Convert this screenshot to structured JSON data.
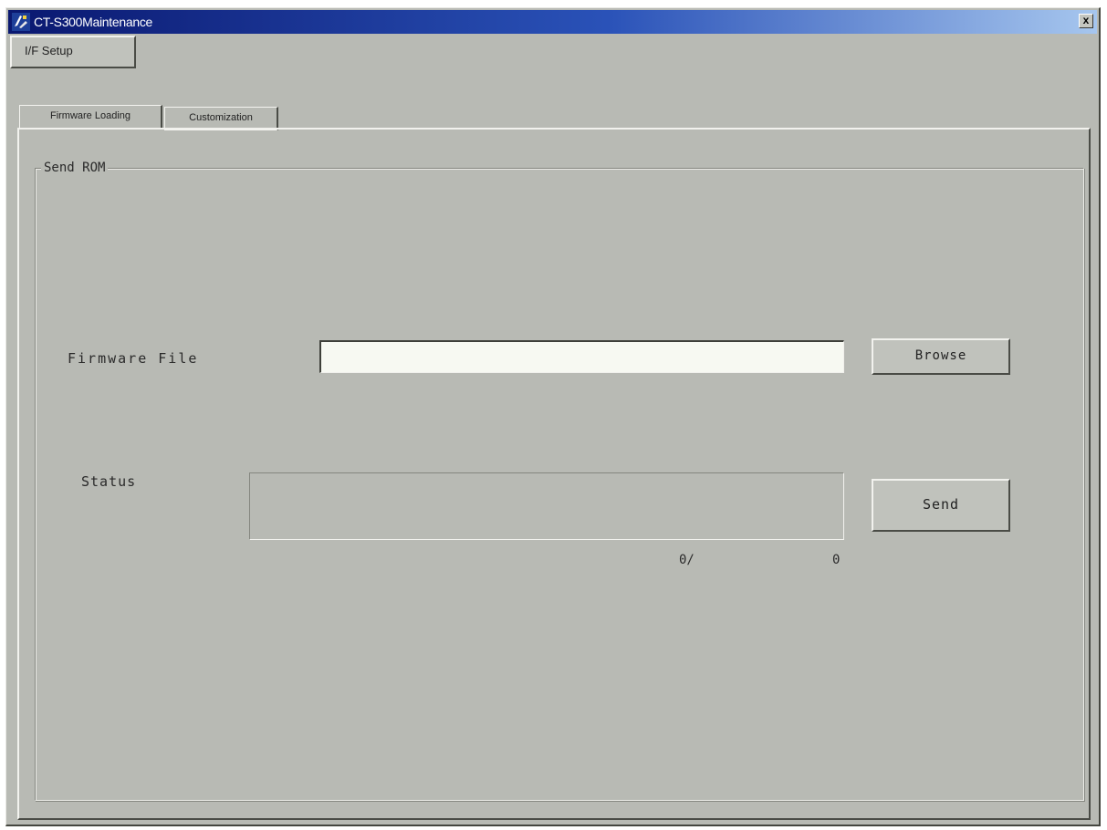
{
  "window": {
    "title": "CT-S300Maintenance",
    "close_label": "x"
  },
  "toolbar": {
    "if_setup_label": "I/F Setup"
  },
  "tabs": [
    {
      "label": "Firmware Loading",
      "selected": true
    },
    {
      "label": "Customization",
      "selected": false
    }
  ],
  "send_rom": {
    "group_title": "Send ROM",
    "firmware_file_label": "Firmware File",
    "firmware_file_value": "",
    "browse_label": "Browse",
    "status_label": "Status",
    "status_text": "",
    "send_label": "Send",
    "progress_current": "0/",
    "progress_total": "0"
  },
  "colors": {
    "face": "#b8bab4",
    "title_start": "#0a1870",
    "title_end": "#a6c6ee",
    "input_bg": "#f7f9f2"
  }
}
